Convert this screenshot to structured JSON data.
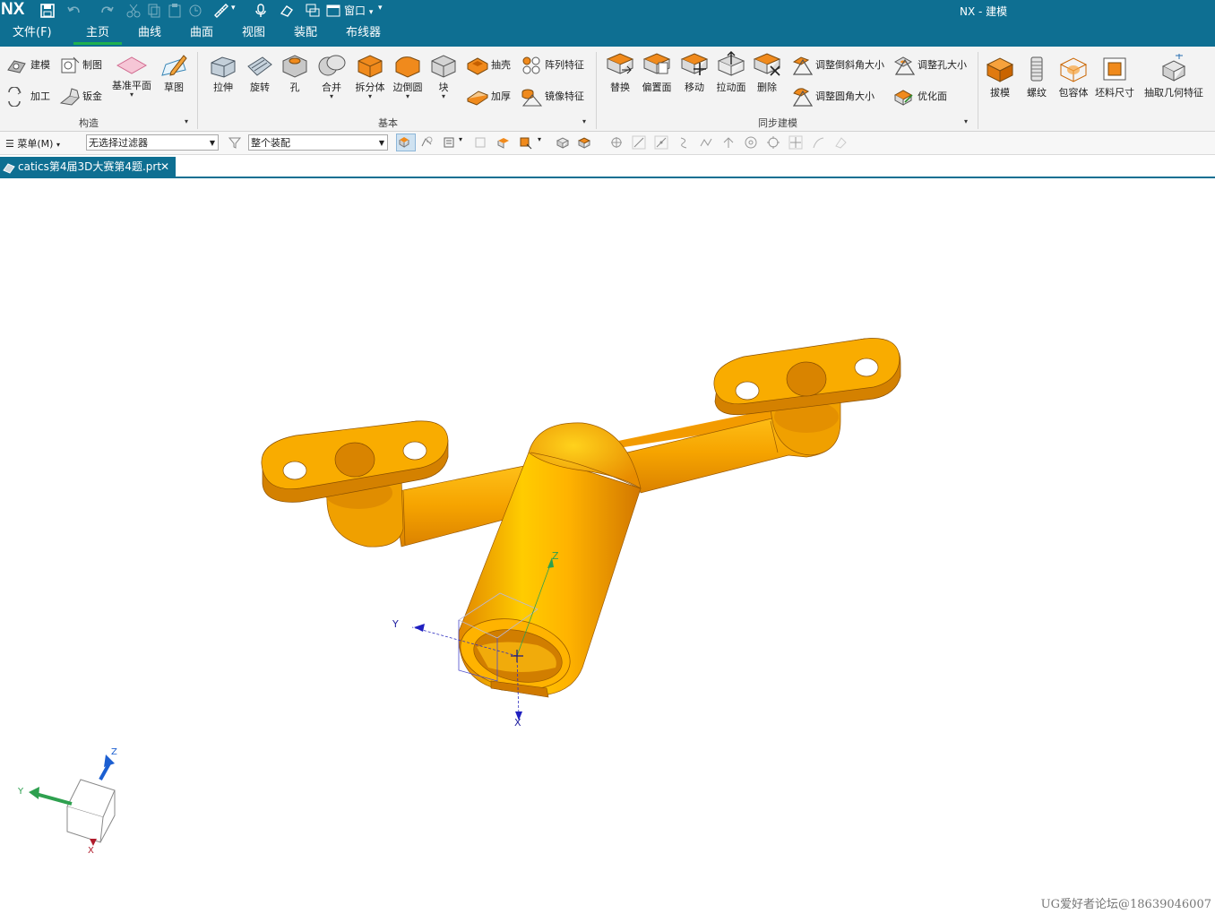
{
  "app": {
    "logo": "NX",
    "title": "NX - 建模",
    "window_menu": "窗口"
  },
  "menubar": {
    "items": [
      "文件(F)",
      "主页",
      "曲线",
      "曲面",
      "视图",
      "装配",
      "布线器"
    ],
    "active": "主页",
    "active_underline_color": "#1fb04f"
  },
  "ribbon": {
    "groups": {
      "construct": "构造",
      "basic": "基本",
      "sync": "同步建模"
    },
    "construct_items": [
      "建模",
      "制图",
      "加工",
      "钣金",
      "基准平面",
      "草图"
    ],
    "basic_items": [
      "拉伸",
      "旋转",
      "孔",
      "合并",
      "拆分体",
      "边倒圆",
      "块",
      "抽壳",
      "阵列特征",
      "加厚",
      "镜像特征"
    ],
    "sync_items": [
      "替换",
      "偏置面",
      "移动",
      "拉动面",
      "删除",
      "调整倒斜角大小",
      "调整孔大小",
      "调整圆角大小",
      "优化面"
    ],
    "extra_items": [
      "拔模",
      "螺纹",
      "包容体",
      "坯料尺寸",
      "抽取几何特征"
    ]
  },
  "toolbar": {
    "menu_label": "菜单(M)",
    "filter_value": "无选择过滤器",
    "scope_value": "整个装配"
  },
  "document": {
    "tab_label": "catics第4届3D大赛第4题.prt"
  },
  "viewport": {
    "axis_labels": {
      "x": "X",
      "y": "Y",
      "z": "Z"
    },
    "model_color": "#f4a300",
    "watermark": "UG爱好者论坛@18639046007"
  },
  "colors": {
    "titlebar": "#0e6f92",
    "ribbon_bg": "#f3f3f3",
    "icon_orange": "#f08a1c"
  }
}
